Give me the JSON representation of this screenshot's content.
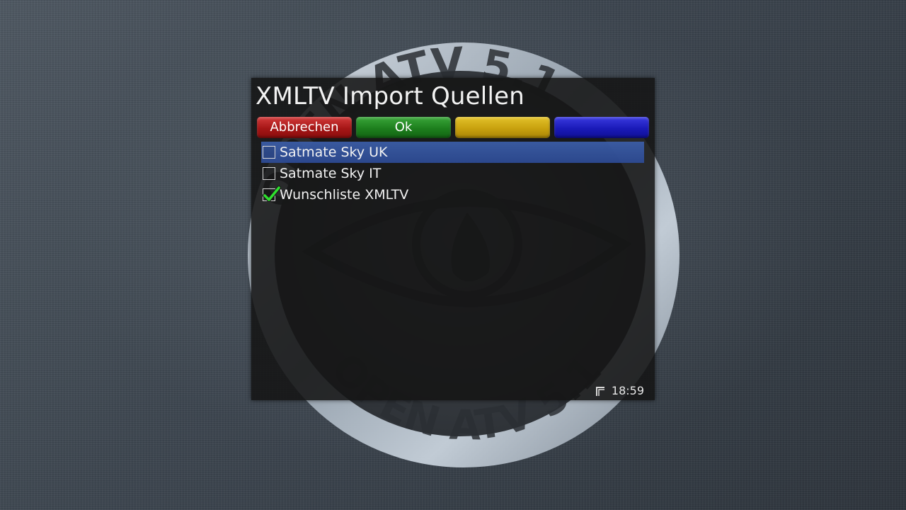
{
  "dialog": {
    "title": "XMLTV Import Quellen"
  },
  "color_keys": {
    "red": {
      "label": "Abbrechen",
      "color": "#a51616"
    },
    "green": {
      "label": "Ok",
      "color": "#1d7e1d"
    },
    "yellow": {
      "label": "",
      "color": "#c8a10e"
    },
    "blue": {
      "label": "",
      "color": "#1a1ab8"
    }
  },
  "sources": [
    {
      "label": "Satmate Sky UK",
      "checked": false,
      "selected": true
    },
    {
      "label": "Satmate Sky IT",
      "checked": false,
      "selected": false
    },
    {
      "label": "Wunschliste XMLTV",
      "checked": true,
      "selected": false
    }
  ],
  "status": {
    "time": "18:59",
    "icon": "record-corner-icon"
  },
  "background": {
    "logo_text": "OPEN ATV 5.1",
    "icon": "eye-logo-icon"
  }
}
